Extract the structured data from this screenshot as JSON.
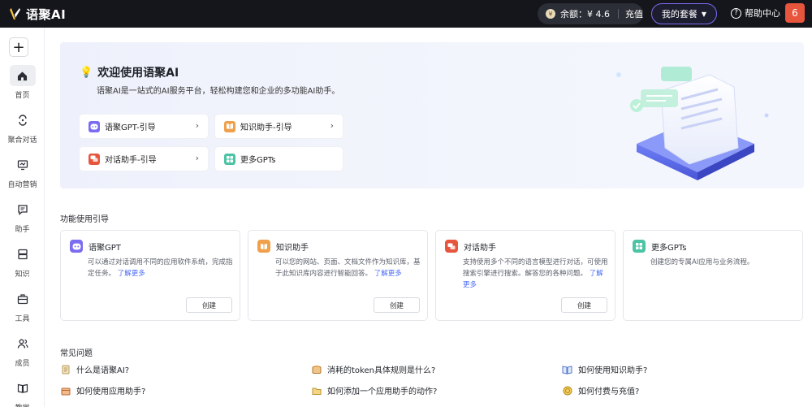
{
  "app": {
    "name": "语聚AI"
  },
  "topbar": {
    "balance_label": "余额：",
    "balance_value": "¥ 4.6",
    "recharge": "充值",
    "plan_label": "我的套餐",
    "help_label": "帮助中心",
    "user_badge": "6"
  },
  "sidebar": {
    "add_label": "+",
    "items": [
      {
        "label": "首页",
        "icon": "home-icon"
      },
      {
        "label": "聚合对话",
        "icon": "chat-merge-icon"
      },
      {
        "label": "自动营销",
        "icon": "monitor-icon"
      },
      {
        "label": "助手",
        "icon": "assistant-icon"
      },
      {
        "label": "知识",
        "icon": "knowledge-icon"
      },
      {
        "label": "工具",
        "icon": "toolbox-icon"
      },
      {
        "label": "成员",
        "icon": "members-icon"
      },
      {
        "label": "教学",
        "icon": "book-icon"
      }
    ]
  },
  "hero": {
    "title": "欢迎使用语聚AI",
    "subtitle": "语聚AI是一站式的AI服务平台，轻松构建您和企业的多功能AI助手。",
    "guides": [
      {
        "label": "语聚GPT-引导",
        "icon": "gpt-icon",
        "color": "#7b6cf0"
      },
      {
        "label": "知识助手-引导",
        "icon": "knowledge-book-icon",
        "color": "#f0a04b"
      },
      {
        "label": "对话助手-引导",
        "icon": "dialog-icon",
        "color": "#e8553d"
      },
      {
        "label": "更多GPTs",
        "icon": "grid-icon",
        "color": "#4cc3a4"
      }
    ]
  },
  "features": {
    "title": "功能使用引导",
    "cards": [
      {
        "title": "语聚GPT",
        "desc": "可以通过对话调用不同的应用软件系统，完成指定任务。",
        "more": "了解更多",
        "button": "创建",
        "color": "#7b6cf0"
      },
      {
        "title": "知识助手",
        "desc": "可以您的网站、页面、文档文件作为知识库，基于此知识库内容进行智能回答。",
        "more": "了解更多",
        "button": "创建",
        "color": "#f0a04b"
      },
      {
        "title": "对话助手",
        "desc": "支持使用多个不同的语言模型进行对话，可使用搜索引擎进行搜索。解答您的各种问题。",
        "more": "了解更多",
        "button": "创建",
        "color": "#e8553d"
      },
      {
        "title": "更多GPTs",
        "desc": "创建您的专属AI应用与业务流程。",
        "more": "",
        "button": "",
        "color": "#4cc3a4"
      }
    ]
  },
  "faq": {
    "title": "常见问题",
    "items": [
      {
        "label": "什么是语聚AI?",
        "icon": "doc-icon"
      },
      {
        "label": "消耗的token具体规则是什么?",
        "icon": "token-icon"
      },
      {
        "label": "如何使用知识助手?",
        "icon": "open-book-icon"
      },
      {
        "label": "如何使用应用助手?",
        "icon": "box-icon"
      },
      {
        "label": "如何添加一个应用助手的动作?",
        "icon": "folder-icon"
      },
      {
        "label": "如何付费与充值?",
        "icon": "coin-icon"
      }
    ]
  }
}
